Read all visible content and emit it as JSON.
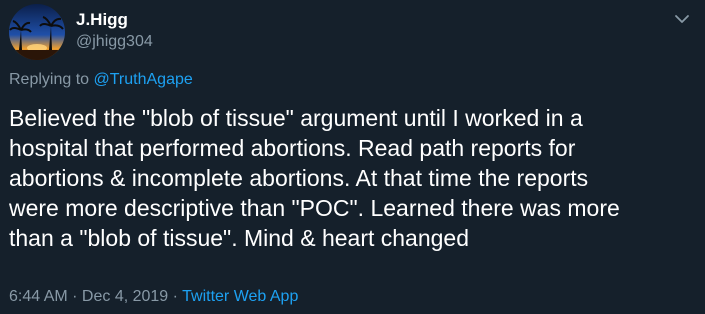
{
  "user": {
    "display_name": "J.Higg",
    "handle": "@jhigg304"
  },
  "reply": {
    "prefix": "Replying to ",
    "mention": "@TruthAgape"
  },
  "tweet": {
    "text": "Believed the \"blob of tissue\" argument until I worked in a\nhospital that performed abortions. Read path reports for\nabortions &  incomplete abortions. At that time the reports\nwere more descriptive than \"POC\". Learned  there was more\nthan a \"blob of tissue\". Mind & heart changed"
  },
  "meta": {
    "time": "6:44 AM · Dec 4, 2019",
    "separator": " · ",
    "source": "Twitter Web App"
  },
  "icons": {
    "caret": "chevron-down-icon"
  },
  "colors": {
    "background": "#15202b",
    "text": "#ffffff",
    "secondary": "#8899a6",
    "link": "#1da1f2"
  }
}
